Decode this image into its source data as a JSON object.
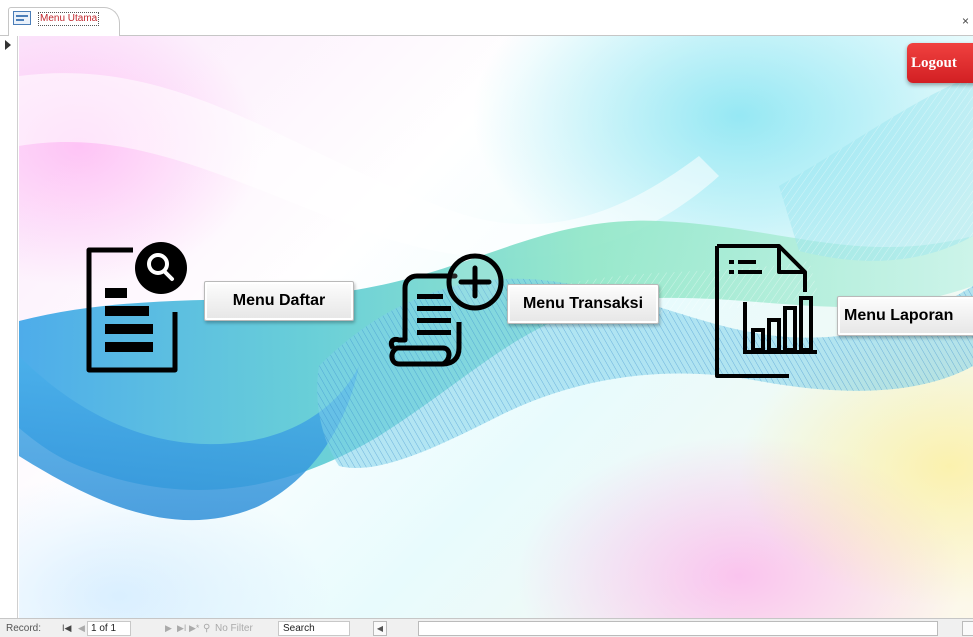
{
  "tab": {
    "title": "Menu Utama",
    "icon": "form-icon",
    "close_glyph": "×"
  },
  "form": {
    "logout_label": "Logout",
    "buttons": [
      {
        "label": "Menu Daftar",
        "icon": "document-search-icon"
      },
      {
        "label": "Menu Transaksi",
        "icon": "receipt-add-icon"
      },
      {
        "label": "Menu Laporan",
        "icon": "report-chart-icon"
      }
    ]
  },
  "statusbar": {
    "record_label": "Record:",
    "first_glyph": "I◀",
    "prev_glyph": "◀",
    "position": "1 of 1",
    "next_glyph": "▶",
    "last_glyph": "▶I",
    "new_glyph": "▶*",
    "filter_label": "No Filter",
    "search_label": "Search",
    "scroll_left_glyph": "◀"
  },
  "colors": {
    "logout_red": "#e02b2e",
    "tab_title_red": "#c0272d",
    "wave_teal": "#5dd6c4",
    "wave_blue": "#4aa8e0",
    "icon_black": "#000000"
  }
}
